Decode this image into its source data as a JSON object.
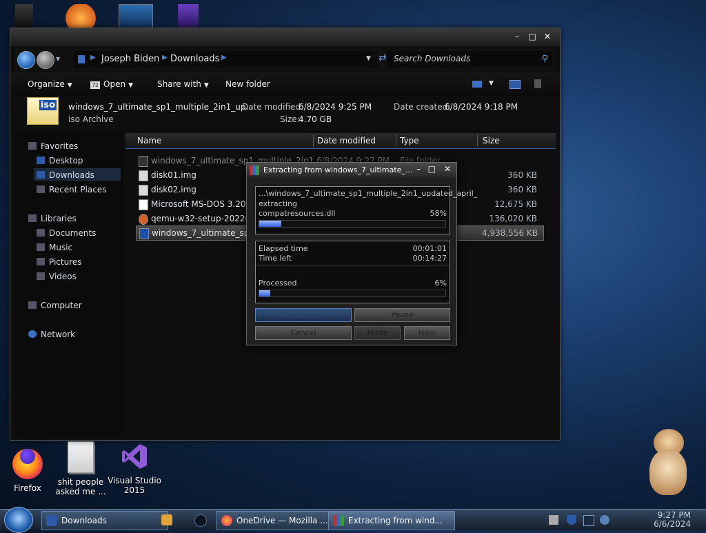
{
  "desktop": {
    "icons": [
      {
        "label": "Firefox"
      },
      {
        "label": "shit people asked me ..."
      },
      {
        "label": "Visual Studio 2015"
      }
    ]
  },
  "explorer": {
    "address": {
      "crumbs": [
        "Joseph Biden",
        "Downloads"
      ],
      "search_placeholder": "Search Downloads"
    },
    "commands": {
      "organize": "Organize",
      "open": "Open",
      "share_with": "Share with",
      "new_folder": "New folder"
    },
    "details": {
      "name": "windows_7_ultimate_sp1_multiple_2in1_up...",
      "type": "iso Archive",
      "date_modified_label": "Date modified:",
      "date_modified": "6/8/2024 9:25 PM",
      "date_created_label": "Date created:",
      "date_created": "6/8/2024 9:18 PM",
      "size_label": "Size:",
      "size": "4.70 GB"
    },
    "nav": {
      "favorites": "Favorites",
      "desktop": "Desktop",
      "downloads": "Downloads",
      "recent": "Recent Places",
      "libraries": "Libraries",
      "documents": "Documents",
      "music": "Music",
      "pictures": "Pictures",
      "videos": "Videos",
      "computer": "Computer",
      "network": "Network"
    },
    "columns": {
      "name": "Name",
      "date_modified": "Date modified",
      "type": "Type",
      "size": "Size"
    },
    "files": [
      {
        "name": "windows_7_ultimate_sp1_multiple_2in1...",
        "date": "6/8/2024 9:27 PM",
        "type": "File folder",
        "size": ""
      },
      {
        "name": "disk01.img",
        "date": "",
        "type": "",
        "size": "360 KB"
      },
      {
        "name": "disk02.img",
        "date": "",
        "type": "",
        "size": "360 KB"
      },
      {
        "name": "Microsoft MS-DOS 3.20 (19",
        "date": "",
        "type": "",
        "size": "12,675 KB"
      },
      {
        "name": "qemu-w32-setup-2022041",
        "date": "",
        "type": "",
        "size": "136,020 KB"
      },
      {
        "name": "windows_7_ultimate_sp1_u",
        "date": "",
        "type": "",
        "size": "4,938,556 KB"
      }
    ]
  },
  "dialog": {
    "title": "Extracting from windows_7_ultimate_...",
    "path": "...\\windows_7_ultimate_sp1_multiple_2in1_updated_april_",
    "action": "extracting",
    "current_file": "compatresources.dll",
    "file_percent": "58%",
    "file_progress": 0.12,
    "elapsed_label": "Elapsed time",
    "elapsed": "00:01:01",
    "left_label": "Time left",
    "left": "00:14:27",
    "processed_label": "Processed",
    "processed_percent": "6%",
    "processed_progress": 0.06,
    "buttons": {
      "background": "Background",
      "pause": "Pause",
      "cancel": "Cancel",
      "mode": "Mode",
      "help": "Help"
    }
  },
  "taskbar": {
    "items": [
      {
        "label": "Downloads"
      },
      {
        "label": "OneDrive — Mozilla ..."
      },
      {
        "label": "Extracting from wind..."
      }
    ],
    "time": "9:27 PM",
    "date": "6/6/2024"
  }
}
